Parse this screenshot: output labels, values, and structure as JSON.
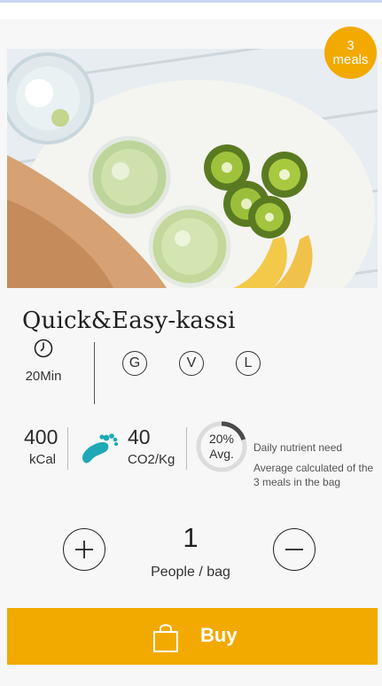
{
  "badge": {
    "count": "3",
    "unit": "meals"
  },
  "recipe": {
    "title": "Quick&Easy-kassi"
  },
  "info": {
    "time": "20Min",
    "diet_tags": [
      "G",
      "V",
      "L"
    ]
  },
  "nutrition": {
    "kcal_value": "400",
    "kcal_unit": "kCal",
    "co2_value": "40",
    "co2_unit": "CO2/Kg",
    "daily_percent_label": "20%",
    "daily_avg_label": "Avg.",
    "daily_fraction": 0.2,
    "daily_title": "Daily nutrient need",
    "daily_desc": "Average calculated of the 3 meals in the bag"
  },
  "quantity": {
    "value": "1",
    "label": "People / bag"
  },
  "buy": {
    "label": "Buy"
  },
  "colors": {
    "accent": "#f2a900",
    "footprint": "#1fa9b6"
  },
  "icons": [
    "clock-icon",
    "footprint-icon",
    "plus-icon",
    "minus-icon",
    "shopping-bag-icon"
  ]
}
